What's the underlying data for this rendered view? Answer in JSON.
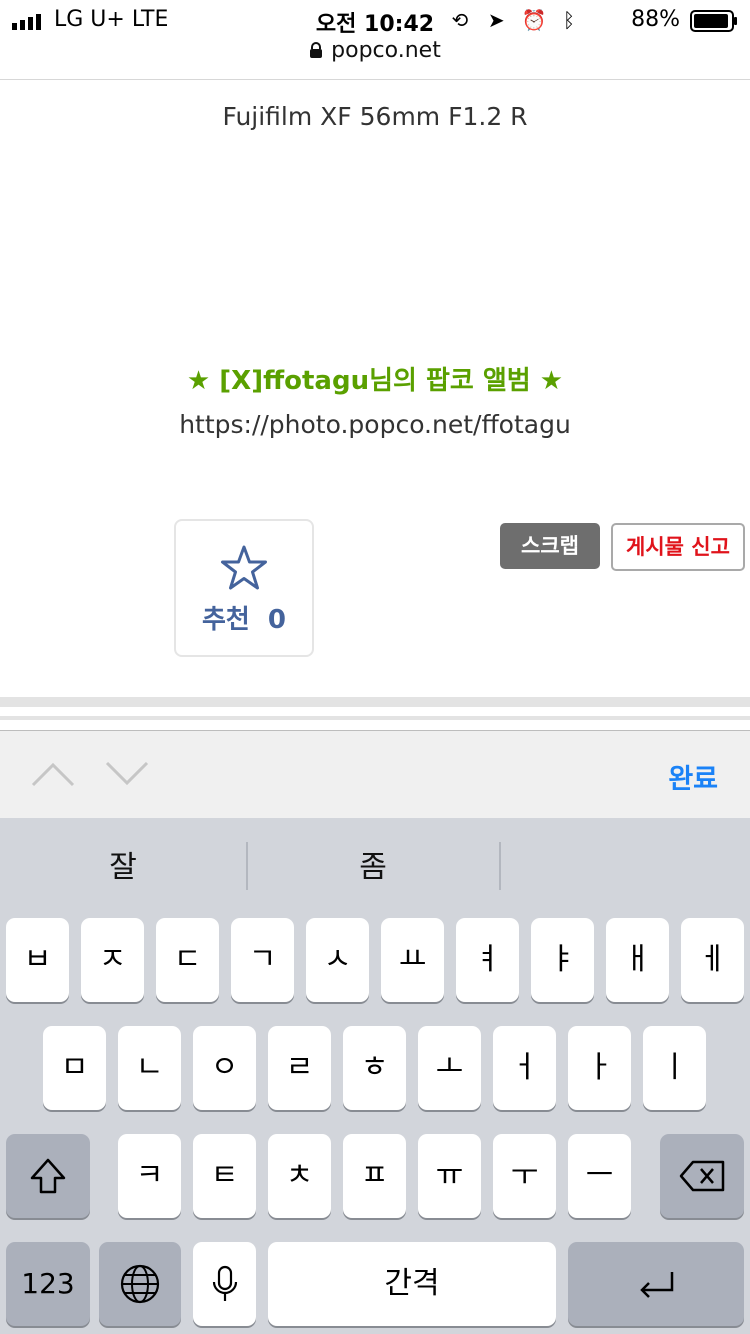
{
  "status_bar": {
    "carrier": "LG U+  LTE",
    "time": "오전 10:42",
    "battery": "88%",
    "icons": [
      "orientation-lock-icon",
      "location-arrow-icon",
      "alarm-icon",
      "bluetooth-icon"
    ]
  },
  "browser": {
    "url": "popco.net"
  },
  "content": {
    "lens": "Fujifilm XF 56mm F1.2 R",
    "album_title": "★ [X]ffotagu님의 팝코 앨범 ★",
    "album_url": "https://photo.popco.net/ffotagu",
    "recommend_label": "추천",
    "recommend_count": "0",
    "scrap_button": "스크랩",
    "report_button": "게시물 신고"
  },
  "accessory": {
    "done": "완료"
  },
  "keyboard": {
    "suggestions": [
      "잘",
      "좀",
      ""
    ],
    "row1": [
      "ㅂ",
      "ㅈ",
      "ㄷ",
      "ㄱ",
      "ㅅ",
      "ㅛ",
      "ㅕ",
      "ㅑ",
      "ㅐ",
      "ㅔ"
    ],
    "row2": [
      "ㅁ",
      "ㄴ",
      "ㅇ",
      "ㄹ",
      "ㅎ",
      "ㅗ",
      "ㅓ",
      "ㅏ",
      "ㅣ"
    ],
    "row3": [
      "ㅋ",
      "ㅌ",
      "ㅊ",
      "ㅍ",
      "ㅠ",
      "ㅜ",
      "ㅡ"
    ],
    "numbers_key": "123",
    "space_key": "간격"
  },
  "colors": {
    "album_green": "#5aa000",
    "recommend_blue": "#44639c",
    "report_red": "#e0131b",
    "done_blue": "#1a82f7"
  }
}
